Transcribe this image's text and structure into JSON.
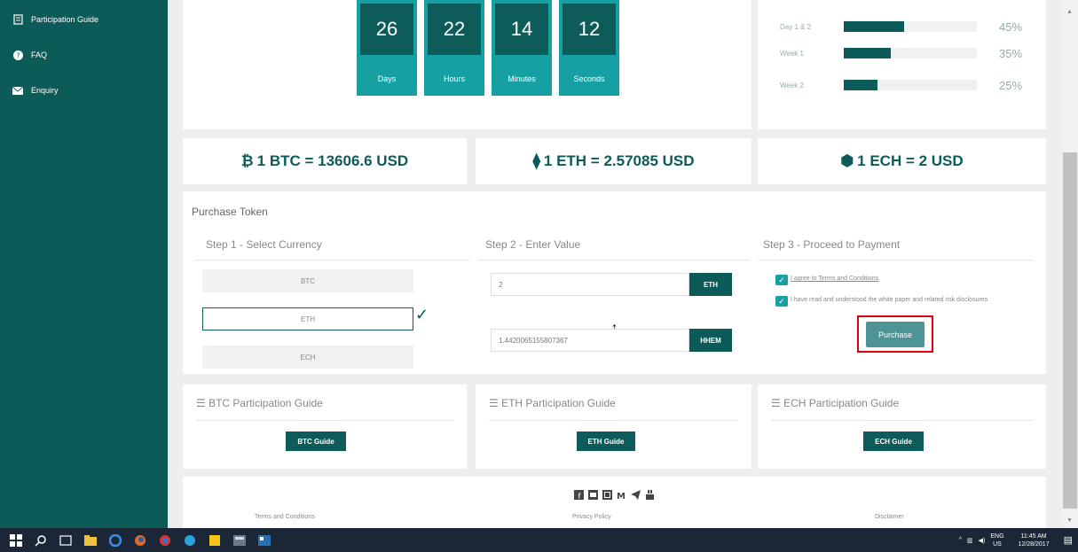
{
  "sidebar": {
    "items": [
      {
        "label": "Participation Guide",
        "icon": "document-icon"
      },
      {
        "label": "FAQ",
        "icon": "help-icon"
      },
      {
        "label": "Enquiry",
        "icon": "envelope-icon"
      }
    ]
  },
  "countdown": {
    "days": "26",
    "days_label": "Days",
    "hours": "22",
    "hours_label": "Hours",
    "minutes": "14",
    "minutes_label": "Minutes",
    "seconds": "12",
    "seconds_label": "Seconds"
  },
  "bonus": [
    {
      "label": "Day 1 & 2",
      "percent": "45%",
      "fill": 0.45
    },
    {
      "label": "Week 1",
      "percent": "35%",
      "fill": 0.35
    },
    {
      "label": "Week 2",
      "percent": "25%",
      "fill": 0.25
    }
  ],
  "rates": {
    "btc": {
      "symbol": "₿",
      "text": "1 BTC = 13606.6 USD"
    },
    "eth": {
      "symbol": "⧫",
      "text": "1 ETH = 2.57085 USD"
    },
    "ech": {
      "symbol": "⬢",
      "text": "1 ECH = 2 USD"
    }
  },
  "purchase": {
    "title": "Purchase Token",
    "step1_title": "Step 1 - Select Currency",
    "step2_title": "Step 2 - Enter Value",
    "step3_title": "Step 3 - Proceed to Payment",
    "currencies": [
      "BTC",
      "ETH",
      "ECH"
    ],
    "selected_currency": "ETH",
    "amount_value": "2",
    "amount_unit": "ETH",
    "converted_value": "1.4420065155807367",
    "converted_unit": "HHEM",
    "agree_terms": "I agree to Terms and Conditions",
    "agree_whitepaper": "I have read and understood the white paper and related risk disclosures",
    "purchase_button": "Purchase"
  },
  "guides": [
    {
      "title": "BTC Participation Guide",
      "button": "BTC Guide"
    },
    {
      "title": "ETH Participation Guide",
      "button": "ETH Guide"
    },
    {
      "title": "ECH Participation Guide",
      "button": "ECH Guide"
    }
  ],
  "footer": {
    "terms": "Terms and Conditions",
    "privacy": "Privacy Policy",
    "disclaimer": "Disclaimer"
  },
  "taskbar": {
    "lang_top": "ENG",
    "lang_bottom": "US",
    "time": "11:45 AM",
    "date": "12/28/2017"
  }
}
